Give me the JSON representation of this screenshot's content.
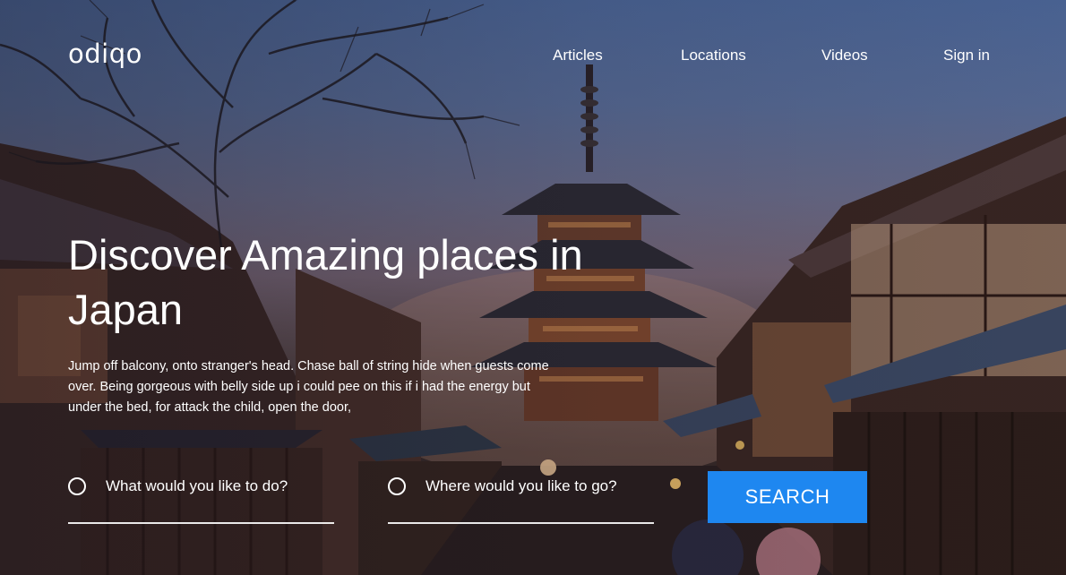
{
  "brand": {
    "logo": "odiqo"
  },
  "nav": {
    "items": [
      {
        "label": "Articles"
      },
      {
        "label": "Locations"
      },
      {
        "label": "Videos"
      },
      {
        "label": "Sign in"
      }
    ]
  },
  "hero": {
    "headline": "Discover Amazing places in Japan",
    "description": "Jump off balcony, onto stranger's head. Chase ball of string hide when guests come over. Being gorgeous with belly side up i could pee on this if i had the energy but under the bed, for attack the child, open the door,"
  },
  "search": {
    "activity_placeholder": "What would you like to do?",
    "location_placeholder": "Where would you like to go?",
    "button_label": "SEARCH"
  },
  "colors": {
    "accent": "#1e87f0",
    "text": "#ffffff"
  }
}
